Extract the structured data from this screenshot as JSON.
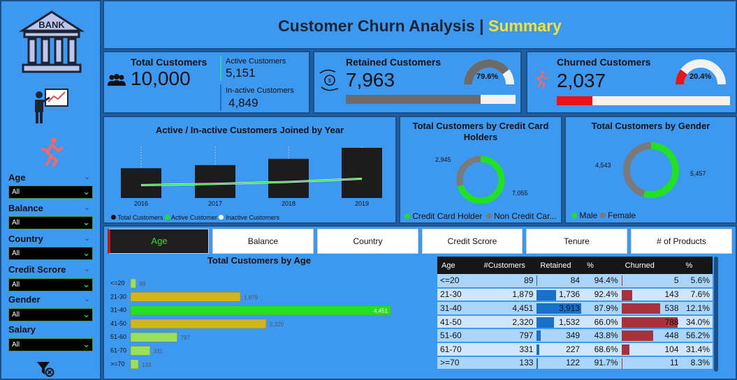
{
  "colors": {
    "accent": "#f2e233",
    "active_green": "#22e022",
    "churn_red": "#e81515",
    "bar_gold": "#d4b418",
    "bar_light_green": "#9be05a"
  },
  "header": {
    "title": "Customer Churn Analysis | ",
    "title_highlight": "Summary"
  },
  "sidebar": {
    "icons": [
      "bank-icon",
      "presenter-icon",
      "runner-icon"
    ],
    "bank_text": "BANK",
    "filters": [
      {
        "label": "Age",
        "value": "All"
      },
      {
        "label": "Balance",
        "value": "All"
      },
      {
        "label": "Country",
        "value": "All"
      },
      {
        "label": "Credit Scrore",
        "value": "All"
      },
      {
        "label": "Gender",
        "value": "All"
      },
      {
        "label": "Salary",
        "value": "All"
      }
    ]
  },
  "kpis": {
    "total": {
      "title": "Total Customers",
      "value": "10,000",
      "active_label": "Active Customers",
      "active_value": "5,151",
      "inactive_label": "In-active Customers",
      "inactive_value": "4,849"
    },
    "retained": {
      "title": "Retained Customers",
      "value": "7,963",
      "pct": "79.6%",
      "fraction": 0.796
    },
    "churned": {
      "title": "Churned Customers",
      "value": "2,037",
      "pct": "20.4%",
      "fraction": 0.204
    }
  },
  "year_chart": {
    "title": "Active / In-active Customers Joined by Year",
    "legend": [
      "Total Customers",
      "Active Customer",
      "Inactive Customers"
    ],
    "chart_data": {
      "type": "bar",
      "categories": [
        "2016",
        "2017",
        "2018",
        "2019"
      ],
      "series": [
        {
          "name": "Total Customers",
          "values": [
            38,
            42,
            50,
            64
          ]
        },
        {
          "name": "Active Customer",
          "values": [
            20,
            22,
            25,
            30
          ]
        },
        {
          "name": "Inactive Customers",
          "values": [
            18,
            20,
            25,
            34
          ]
        }
      ]
    }
  },
  "credit_chart": {
    "title": "Total Customers by Credit Card Holders",
    "label_a": "2,945",
    "label_b": "7,055",
    "legend": [
      "Credit Card Holder",
      "Non Credit Car..."
    ],
    "chart_data": {
      "type": "pie",
      "categories": [
        "Credit Card Holder",
        "Non Credit Card Holder"
      ],
      "values": [
        7055,
        2945
      ]
    }
  },
  "gender_chart": {
    "title": "Total Customers by Gender",
    "label_a": "4,543",
    "label_b": "5,457",
    "legend": [
      "Male",
      "Female"
    ],
    "chart_data": {
      "type": "pie",
      "categories": [
        "Male",
        "Female"
      ],
      "values": [
        5457,
        4543
      ]
    }
  },
  "tabs": [
    "Age",
    "Balance",
    "Country",
    "Credit Scrore",
    "Tenure",
    "# of Products"
  ],
  "age_chart": {
    "title": "Total Customers by Age",
    "chart_data": {
      "type": "bar",
      "categories": [
        "<=20",
        "21-30",
        "31-40",
        "41-50",
        "51-60",
        "61-70",
        ">=70"
      ],
      "values": [
        89,
        1879,
        4451,
        2320,
        797,
        331,
        133
      ],
      "labels": [
        "89",
        "1,879",
        "4,451",
        "2,320",
        "797",
        "331",
        "133"
      ],
      "xlim": [
        0,
        4451
      ]
    }
  },
  "age_table": {
    "headers": [
      "Age",
      "#Customers",
      "Retained",
      "%",
      "Churned",
      "%"
    ],
    "max_retained": 3913,
    "max_churned": 788,
    "rows": [
      {
        "age": "<=20",
        "customers": "89",
        "retained": "84",
        "retained_n": 84,
        "ret_pct": "94.4%",
        "churned": "5",
        "churned_n": 5,
        "churn_pct": "5.6%"
      },
      {
        "age": "21-30",
        "customers": "1,879",
        "retained": "1,736",
        "retained_n": 1736,
        "ret_pct": "92.4%",
        "churned": "143",
        "churned_n": 143,
        "churn_pct": "7.6%"
      },
      {
        "age": "31-40",
        "customers": "4,451",
        "retained": "3,913",
        "retained_n": 3913,
        "ret_pct": "87.9%",
        "churned": "538",
        "churned_n": 538,
        "churn_pct": "12.1%"
      },
      {
        "age": "41-50",
        "customers": "2,320",
        "retained": "1,532",
        "retained_n": 1532,
        "ret_pct": "66.0%",
        "churned": "788",
        "churned_n": 788,
        "churn_pct": "34.0%"
      },
      {
        "age": "51-60",
        "customers": "797",
        "retained": "349",
        "retained_n": 349,
        "ret_pct": "43.8%",
        "churned": "448",
        "churned_n": 448,
        "churn_pct": "56.2%"
      },
      {
        "age": "61-70",
        "customers": "331",
        "retained": "227",
        "retained_n": 227,
        "ret_pct": "68.6%",
        "churned": "104",
        "churned_n": 104,
        "churn_pct": "31.4%"
      },
      {
        "age": ">=70",
        "customers": "133",
        "retained": "122",
        "retained_n": 122,
        "ret_pct": "91.7%",
        "churned": "11",
        "churned_n": 11,
        "churn_pct": "8.3%"
      }
    ]
  }
}
